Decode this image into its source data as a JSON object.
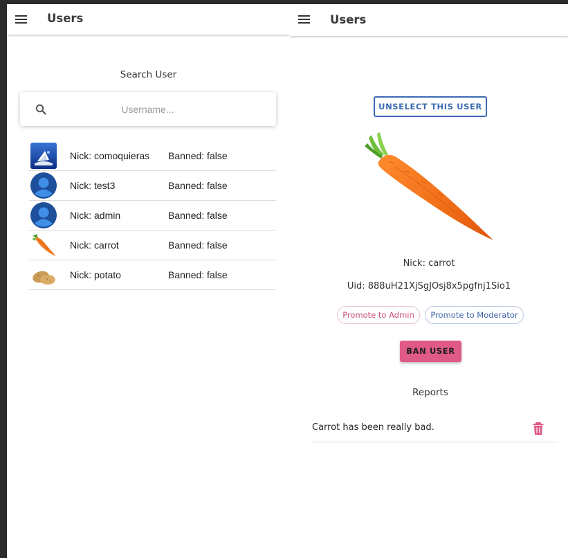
{
  "left": {
    "appbar": {
      "title": "Users",
      "menu_icon": "menu-icon"
    },
    "search": {
      "label": "Search User",
      "placeholder": "Username...",
      "value": "",
      "icon": "search-icon"
    },
    "users": [
      {
        "nick": "Nick: comoquieras",
        "banned": "Banned: false",
        "avatar": "ship-avatar"
      },
      {
        "nick": "Nick: test3",
        "banned": "Banned: false",
        "avatar": "default-user-avatar"
      },
      {
        "nick": "Nick: admin",
        "banned": "Banned: false",
        "avatar": "default-user-avatar"
      },
      {
        "nick": "Nick: carrot",
        "banned": "Banned: false",
        "avatar": "carrot-avatar"
      },
      {
        "nick": "Nick: potato",
        "banned": "Banned: false",
        "avatar": "potato-avatar"
      }
    ]
  },
  "right": {
    "appbar": {
      "title": "Users",
      "menu_icon": "menu-icon"
    },
    "unselect_label": "UNSELECT THIS USER",
    "selected": {
      "nick": "Nick: carrot",
      "uid": "Uid: 888uH21XjSgJOsj8x5pgfnj1Sio1",
      "image": "carrot-image"
    },
    "promote_admin_label": "Promote to Admin",
    "promote_moderator_label": "Promote to Moderator",
    "ban_label": "BAN USER",
    "reports_title": "Reports",
    "reports": [
      {
        "text": "Carrot has been really bad.",
        "icon": "trash-icon"
      }
    ]
  },
  "colors": {
    "primary_blue": "#3d6bb3",
    "accent_pink": "#e05a86",
    "admin_chip_text": "#c94f78",
    "background": "#ffffff"
  }
}
